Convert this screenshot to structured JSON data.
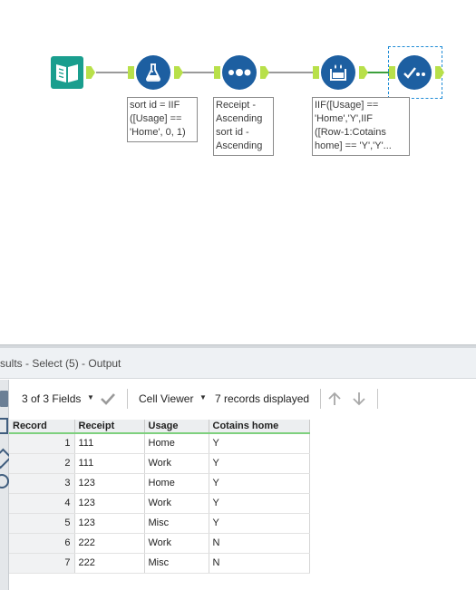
{
  "workflow": {
    "annotations": {
      "formula_sortid": "sort id = IIF\n([Usage] ==\n'Home', 0, 1)",
      "sort": "Receipt -\nAscending\nsort id -\nAscending",
      "multirow": "IIF([Usage] ==\n'Home','Y',IIF\n([Row-1:Cotains\nhome] == 'Y','Y'..."
    },
    "tools": [
      "input-data-icon",
      "formula-icon",
      "sort-icon",
      "multi-row-formula-icon",
      "select-icon"
    ],
    "colors": {
      "tool_blue": "#1d5fa1",
      "input_teal": "#1a9e8e",
      "anchor_green": "#b8e04a"
    }
  },
  "results": {
    "title": "sults - Select (5) - Output",
    "fields_label": "3 of 3 Fields",
    "viewer_label": "Cell Viewer",
    "records_label": "7 records displayed",
    "columns": [
      "Record",
      "Receipt",
      "Usage",
      "Cotains home"
    ],
    "rows": [
      [
        "1",
        "111",
        "Home",
        "Y"
      ],
      [
        "2",
        "111",
        "Work",
        "Y"
      ],
      [
        "3",
        "123",
        "Home",
        "Y"
      ],
      [
        "4",
        "123",
        "Work",
        "Y"
      ],
      [
        "5",
        "123",
        "Misc",
        "Y"
      ],
      [
        "6",
        "222",
        "Work",
        "N"
      ],
      [
        "7",
        "222",
        "Misc",
        "N"
      ]
    ]
  }
}
